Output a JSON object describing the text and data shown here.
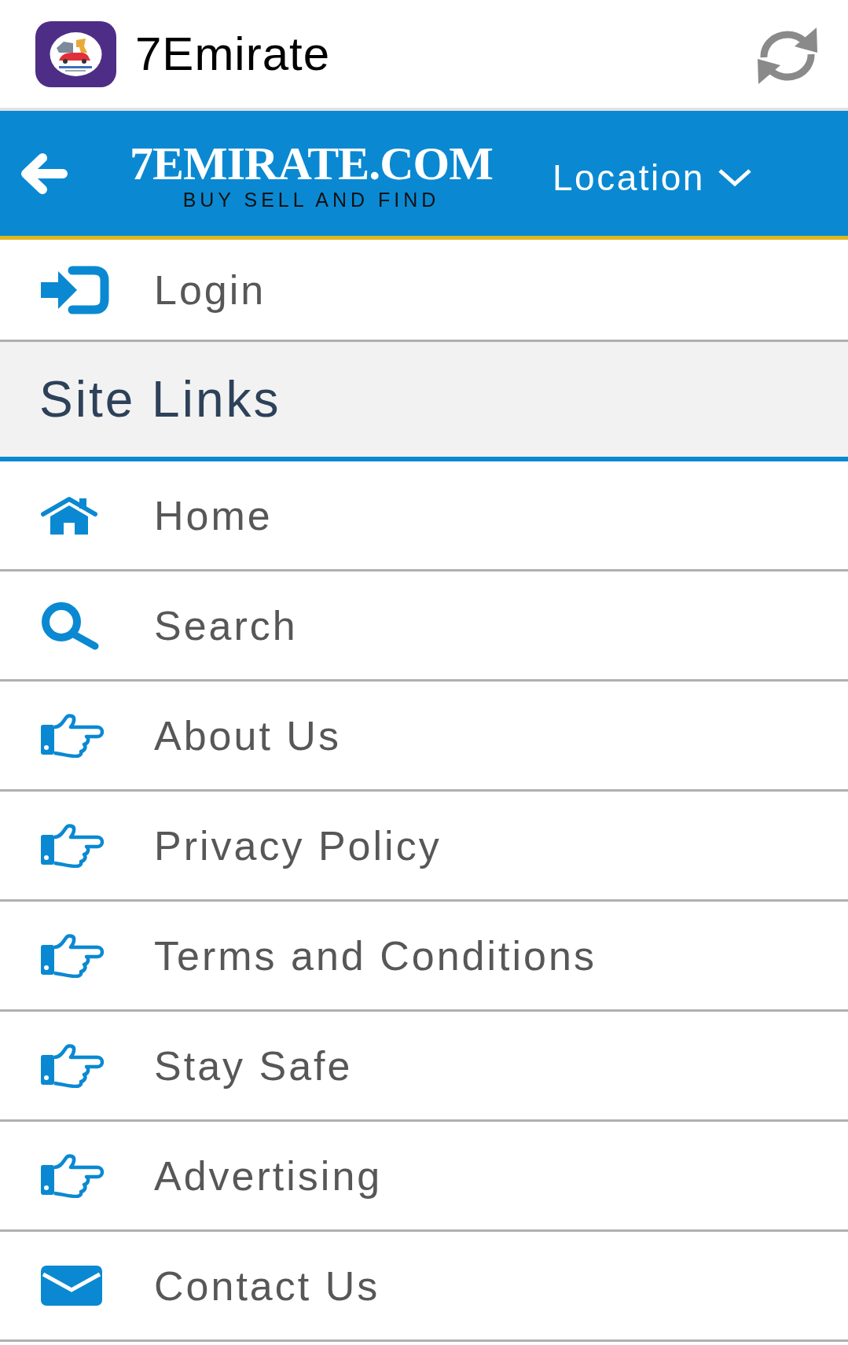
{
  "app_bar": {
    "title": "7Emirate"
  },
  "header": {
    "logo_title": "7EMIRATE.COM",
    "logo_tagline": "BUY SELL AND FIND",
    "location": "Location"
  },
  "account_items": [
    {
      "kind": "login",
      "label": "Login"
    }
  ],
  "site_links": {
    "title": "Site Links",
    "items": [
      {
        "kind": "home",
        "label": "Home"
      },
      {
        "kind": "search",
        "label": "Search"
      },
      {
        "kind": "page",
        "label": "About Us"
      },
      {
        "kind": "page",
        "label": "Privacy Policy"
      },
      {
        "kind": "page",
        "label": "Terms and Conditions"
      },
      {
        "kind": "page",
        "label": "Stay Safe"
      },
      {
        "kind": "page",
        "label": "Advertising"
      },
      {
        "kind": "mail",
        "label": "Contact Us"
      }
    ]
  }
}
